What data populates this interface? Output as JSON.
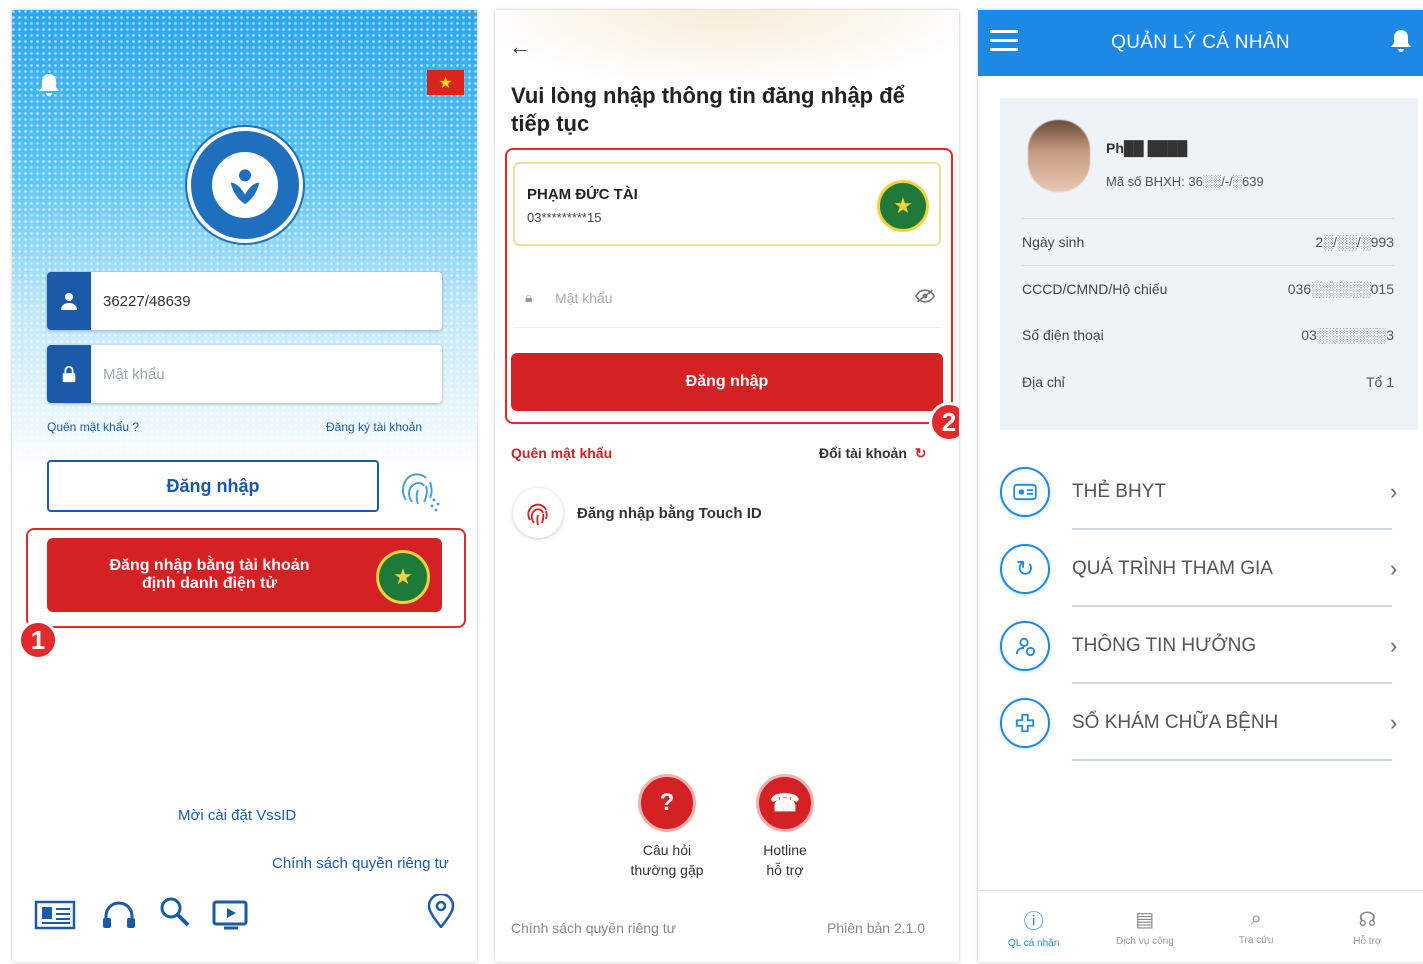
{
  "panel1": {
    "username_value": "36227/48639",
    "password_placeholder": "Mật khẩu",
    "forgot_password": "Quên mật khẩu ?",
    "register": "Đăng ký tài khoản",
    "login_button": "Đăng nhập",
    "eid_login_line1": "Đăng nhập bằng tài khoản",
    "eid_login_line2": "định danh điện tử",
    "step_badge": "1",
    "install_link": "Mời cài đặt VssID",
    "privacy_link": "Chính sách quyền riêng tư",
    "flag_star": "★",
    "colors": {
      "primary": "#1b5aa8",
      "accent_red": "#d32124"
    }
  },
  "panel2": {
    "title": "Vui lòng nhập thông tin đăng nhập để tiếp tục",
    "account_name": "PHẠM ĐỨC TÀI",
    "account_phone": "03*********15",
    "password_placeholder": "Mật khẩu",
    "login_button": "Đăng nhập",
    "step_badge": "2",
    "forgot_password": "Quên mật khẩu",
    "switch_account": "Đổi tài khoản",
    "touch_id": "Đăng nhập bằng Touch ID",
    "faq_line1": "Câu hỏi",
    "faq_line2": "thường gặp",
    "hotline_line1": "Hotline",
    "hotline_line2": "hỗ trợ",
    "privacy": "Chính sách quyền riêng tư",
    "version": "Phiên bản 2.1.0"
  },
  "panel3": {
    "title": "QUẢN LÝ CÁ NHÂN",
    "name": "Ph██ ████",
    "bhxh": "Mã số BHXH: 36░░/-/░639",
    "rows": [
      {
        "label": "Ngày sinh",
        "value": "2░/░░/░993"
      },
      {
        "label": "CCCD/CMND/Hộ chiếu",
        "value": "036░░░░░░015"
      },
      {
        "label": "Số điện thoại",
        "value": "03░░░░░░░3"
      },
      {
        "label": "Địa chỉ",
        "value": "Tổ 1"
      }
    ],
    "menu": [
      {
        "label": "THẺ BHYT",
        "icon": "card-icon"
      },
      {
        "label": "QUÁ TRÌNH THAM GIA",
        "icon": "refresh-icon"
      },
      {
        "label": "THÔNG TIN HƯỞNG",
        "icon": "user-info-icon"
      },
      {
        "label": "SỔ KHÁM CHỮA BỆNH",
        "icon": "medical-cross-icon"
      }
    ],
    "tabs": [
      {
        "label": "QL cá nhân",
        "icon": "person-icon"
      },
      {
        "label": "Dịch vụ công",
        "icon": "document-icon"
      },
      {
        "label": "Tra cứu",
        "icon": "search-icon"
      },
      {
        "label": "Hỗ trợ",
        "icon": "headset-icon"
      }
    ],
    "colors": {
      "topbar": "#1e88e5"
    }
  }
}
